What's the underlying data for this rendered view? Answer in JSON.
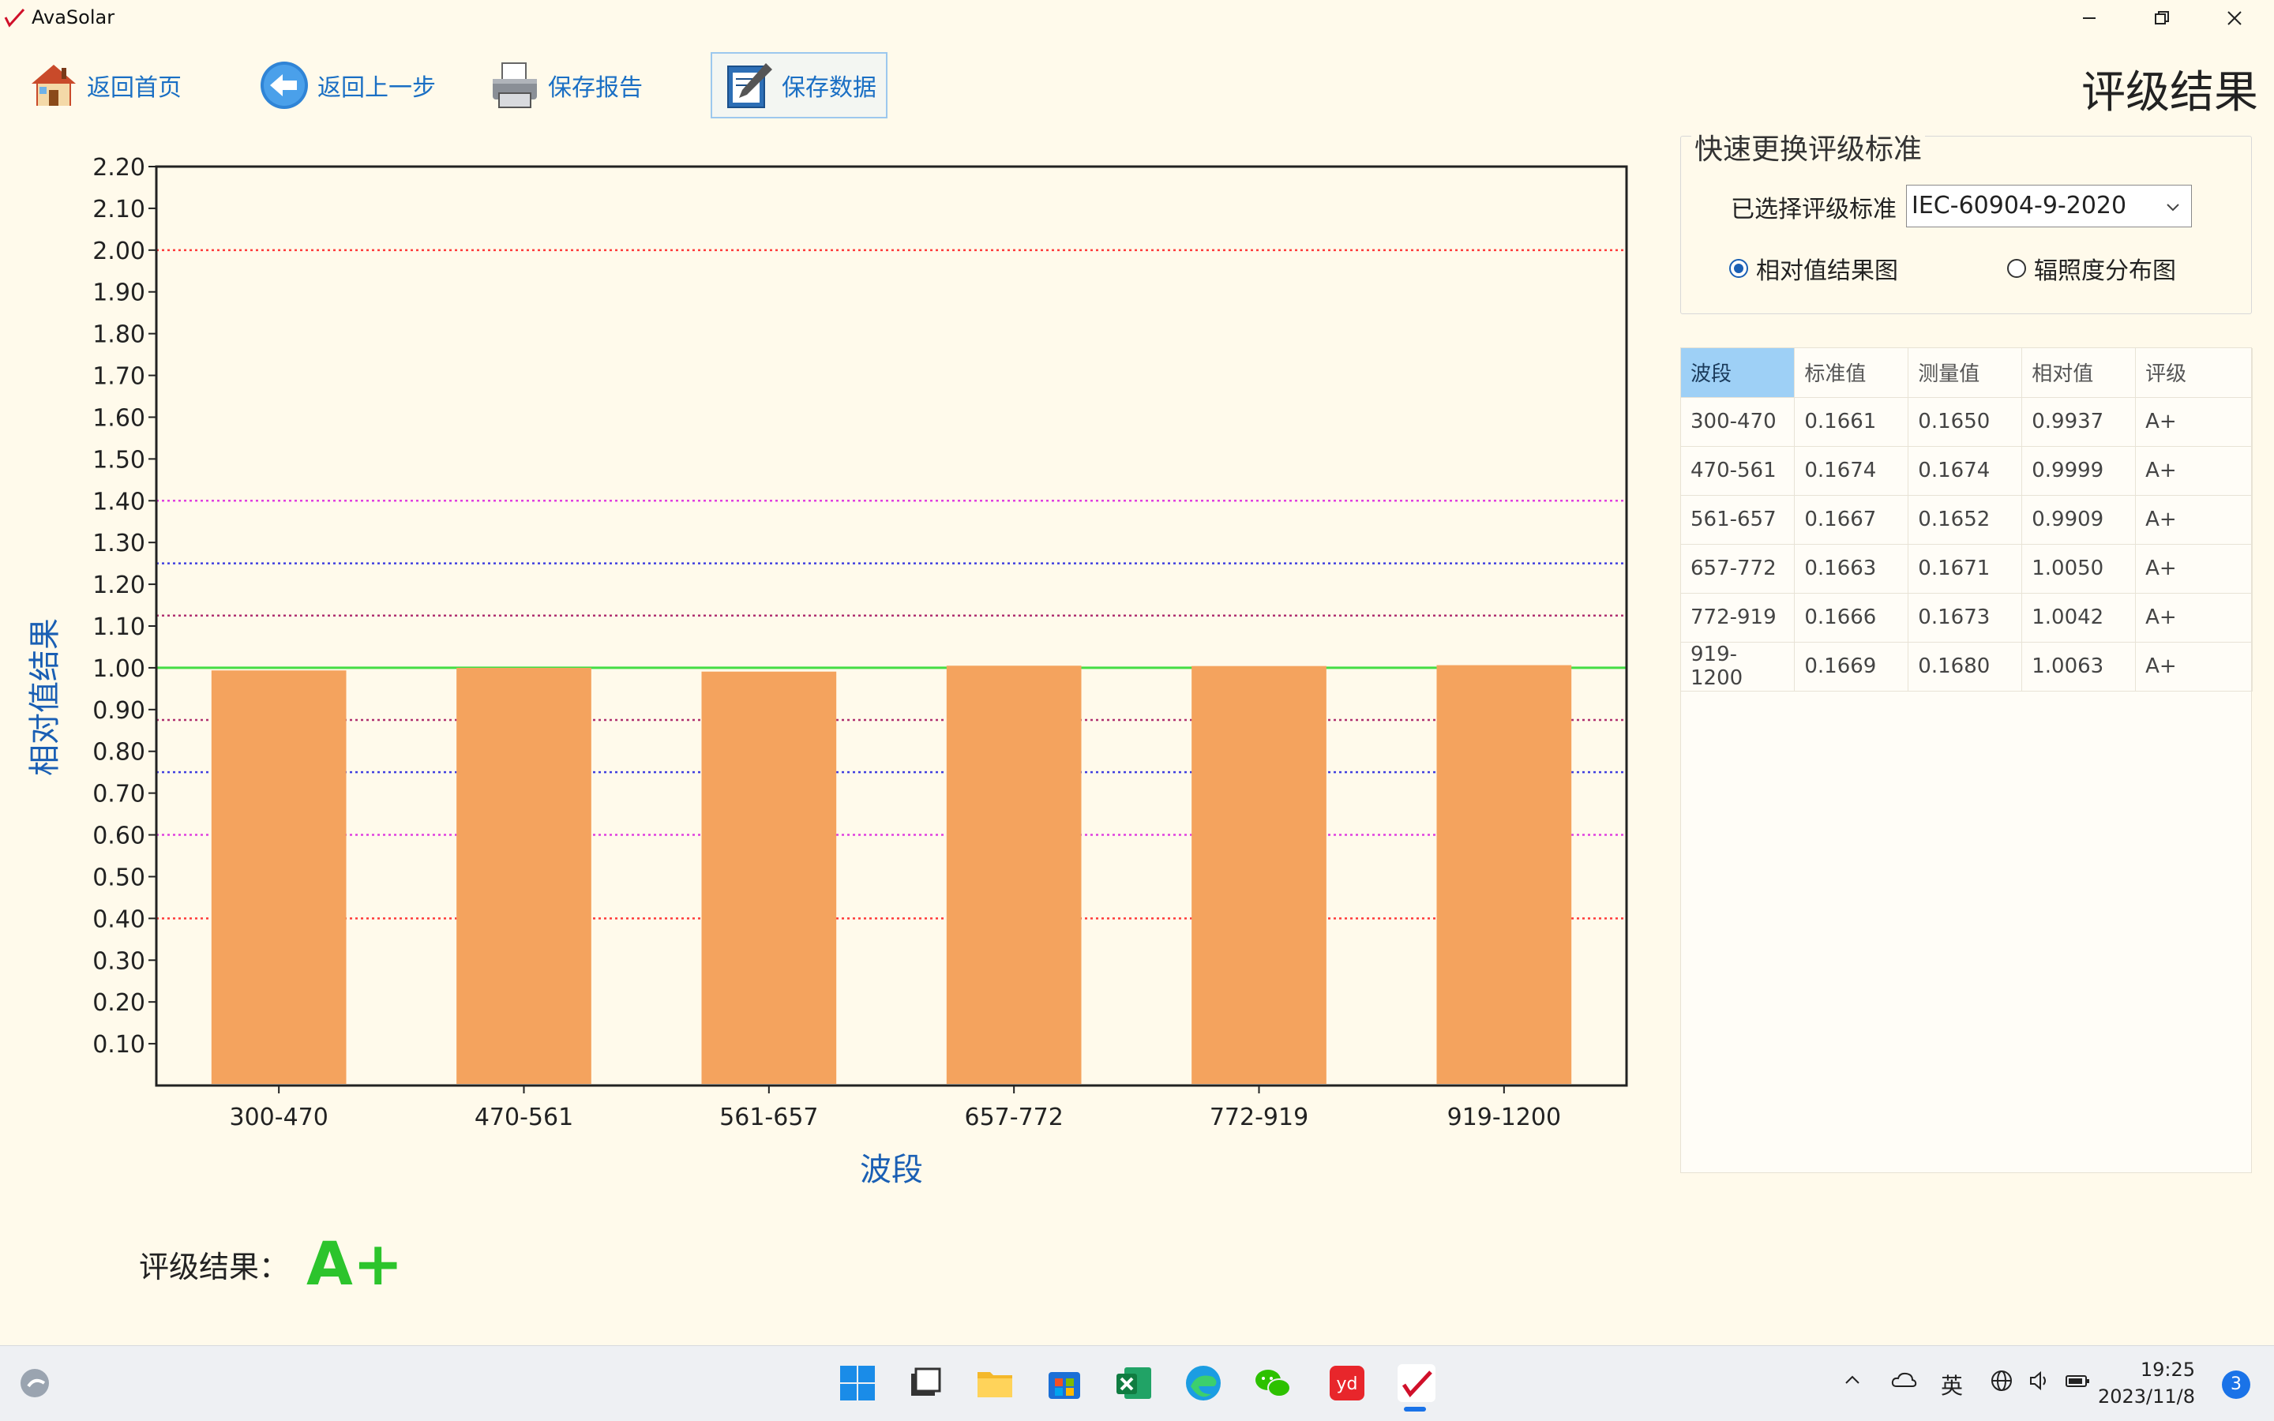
{
  "window": {
    "title": "AvaSolar"
  },
  "toolbar": {
    "home_label": "返回首页",
    "back_label": "返回上一步",
    "save_report_label": "保存报告",
    "save_data_label": "保存数据"
  },
  "page_title": "评级结果",
  "standard_panel": {
    "group_title": "快速更换评级标准",
    "selected_label": "已选择评级标准",
    "selected_value": "IEC-60904-9-2020",
    "radio_relative": "相对值结果图",
    "radio_irradiance": "辐照度分布图",
    "selected_radio": "relative"
  },
  "table": {
    "headers": [
      "波段",
      "标准值",
      "测量值",
      "相对值",
      "评级"
    ],
    "rows": [
      [
        "300-470",
        "0.1661",
        "0.1650",
        "0.9937",
        "A+"
      ],
      [
        "470-561",
        "0.1674",
        "0.1674",
        "0.9999",
        "A+"
      ],
      [
        "561-657",
        "0.1667",
        "0.1652",
        "0.9909",
        "A+"
      ],
      [
        "657-772",
        "0.1663",
        "0.1671",
        "1.0050",
        "A+"
      ],
      [
        "772-919",
        "0.1666",
        "0.1673",
        "1.0042",
        "A+"
      ],
      [
        "919-1200",
        "0.1669",
        "0.1680",
        "1.0063",
        "A+"
      ]
    ]
  },
  "grade": {
    "label": "评级结果：",
    "value": "A+"
  },
  "chart_data": {
    "type": "bar",
    "categories": [
      "300-470",
      "470-561",
      "561-657",
      "657-772",
      "772-919",
      "919-1200"
    ],
    "values": [
      0.9937,
      0.9999,
      0.9909,
      1.005,
      1.0042,
      1.0063
    ],
    "xlabel": "波段",
    "ylabel": "相对值结果",
    "ylim": [
      0,
      2.2
    ],
    "yticks": [
      "0.10",
      "0.20",
      "0.30",
      "0.40",
      "0.50",
      "0.60",
      "0.70",
      "0.80",
      "0.90",
      "1.00",
      "1.10",
      "1.20",
      "1.30",
      "1.40",
      "1.50",
      "1.60",
      "1.70",
      "1.80",
      "1.90",
      "2.00",
      "2.10",
      "2.20"
    ],
    "bar_color": "#f4a35e",
    "reference_lines": [
      {
        "y": 2.0,
        "color": "#ff3b3b",
        "style": "dotted"
      },
      {
        "y": 0.4,
        "color": "#ff3b3b",
        "style": "dotted"
      },
      {
        "y": 1.4,
        "color": "#e040e0",
        "style": "dotted"
      },
      {
        "y": 0.6,
        "color": "#e040e0",
        "style": "dotted"
      },
      {
        "y": 1.25,
        "color": "#4040e0",
        "style": "dotted"
      },
      {
        "y": 0.75,
        "color": "#4040e0",
        "style": "dotted"
      },
      {
        "y": 1.125,
        "color": "#b03070",
        "style": "dotted"
      },
      {
        "y": 0.875,
        "color": "#b03070",
        "style": "dotted"
      },
      {
        "y": 1.0,
        "color": "#44dd44",
        "style": "solid"
      }
    ],
    "grid": false,
    "legend": "none"
  },
  "taskbar": {
    "lang": "英",
    "time": "19:25",
    "date": "2023/11/8",
    "notifications": "3"
  }
}
